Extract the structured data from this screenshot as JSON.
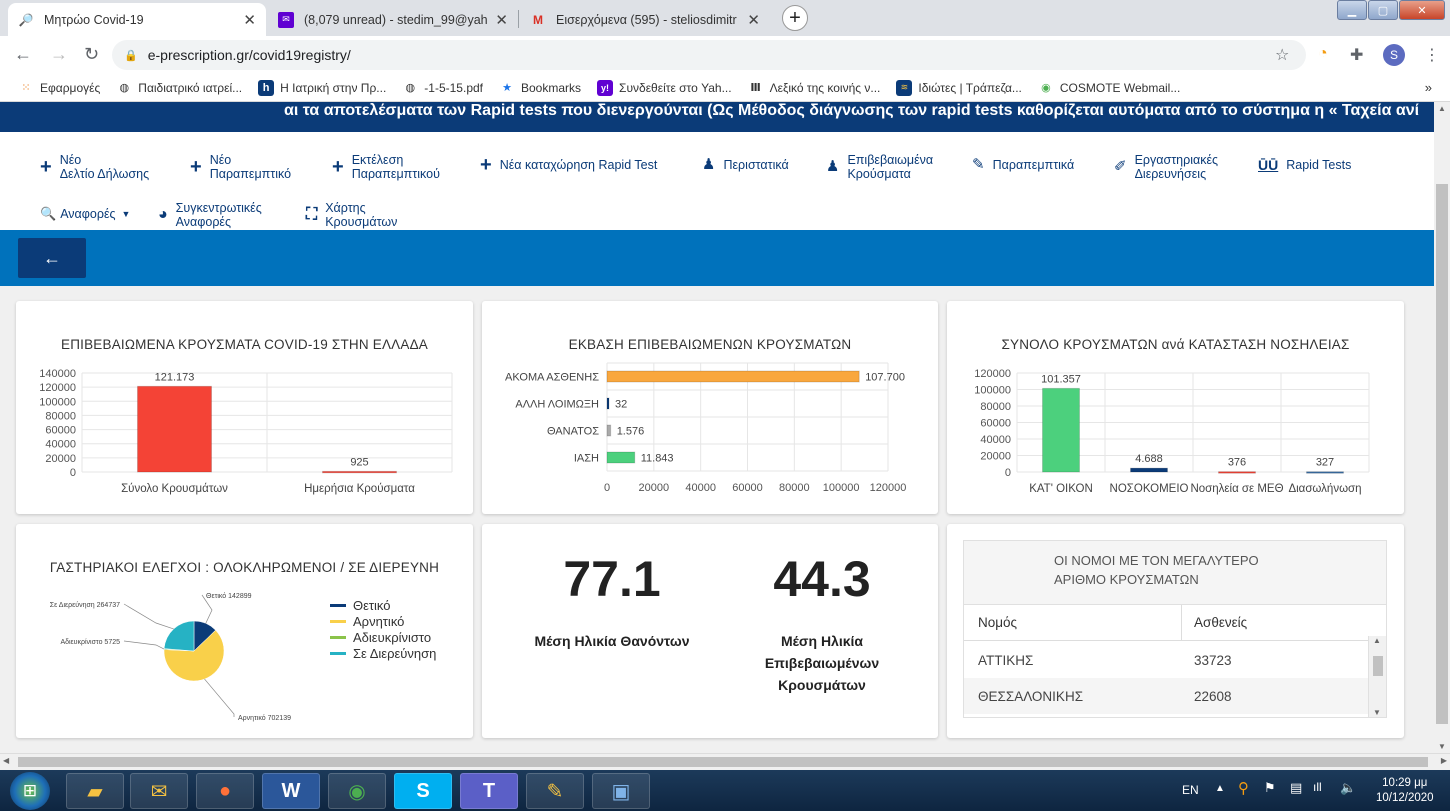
{
  "browser": {
    "tabs": [
      {
        "title": "Μητρώο Covid-19",
        "icon": "covid-registry-favicon",
        "active": true
      },
      {
        "title": "(8,079 unread) - stedim_99@yah",
        "icon": "yahoo-mail-favicon",
        "active": false
      },
      {
        "title": "Εισερχόμενα (595) - steliosdimitr",
        "icon": "gmail-favicon",
        "active": false
      }
    ],
    "url": "e-prescription.gr/covid19registry/",
    "profile_initial": "S",
    "bookmarks": [
      {
        "label": "Εφαρμογές",
        "icon": "apps-grid-icon"
      },
      {
        "label": "Παιδιατρικό ιατρεί...",
        "icon": "globe-icon"
      },
      {
        "label": "Η Ιατρική στην Πρ...",
        "icon": "h-site-icon"
      },
      {
        "label": "-1-5-15.pdf",
        "icon": "globe-icon"
      },
      {
        "label": "Bookmarks",
        "icon": "star-icon"
      },
      {
        "label": "Συνδεθείτε στο Yah...",
        "icon": "yahoo-icon"
      },
      {
        "label": "Λεξικό της κοινής ν...",
        "icon": "dictionary-icon"
      },
      {
        "label": "Ιδιώτες | Τράπεζα...",
        "icon": "bank-icon"
      },
      {
        "label": "COSMOTE Webmail...",
        "icon": "cosmote-icon"
      }
    ],
    "bookmarks_more": "»"
  },
  "page": {
    "marquee": "αι τα αποτελέσματα των Rapid tests που διενεργούνται (Ως Μέθοδος διάγνωσης των rapid tests καθορίζεται αυτόματα από το σύστημα η « Ταχεία ανί",
    "menu": [
      {
        "line1": "Νέο",
        "line2": "Δελτίο Δήλωσης",
        "icon": "plus-icon"
      },
      {
        "line1": "Νέο",
        "line2": "Παραπεμπτικό",
        "icon": "plus-icon"
      },
      {
        "line1": "Εκτέλεση",
        "line2": "Παραπεμπτικού",
        "icon": "plus-icon"
      },
      {
        "line1": "Νέα καταχώρηση Rapid Test",
        "line2": "",
        "icon": "plus-icon"
      },
      {
        "line1": "Περιστατικά",
        "line2": "",
        "icon": "user-doctor-icon"
      },
      {
        "line1": "Επιβεβαιωμένα",
        "line2": "Κρούσματα",
        "icon": "user-doctor-icon"
      },
      {
        "line1": "Παραπεμπτικά",
        "line2": "",
        "icon": "edit-document-icon"
      },
      {
        "line1": "Εργαστηριακές",
        "line2": "Διερευνήσεις",
        "icon": "syringe-icon"
      },
      {
        "line1": "Rapid Tests",
        "line2": "",
        "icon": "test-tubes-icon"
      },
      {
        "line1": "Αναφορές",
        "line2": "",
        "icon": "search-icon"
      },
      {
        "line1": "Συγκεντρωτικές",
        "line2": "Αναφορές",
        "icon": "pie-chart-icon"
      },
      {
        "line1": "Χάρτης",
        "line2": "Κρουσμάτων",
        "icon": "map-icon"
      }
    ],
    "back_label": "←",
    "kpi": {
      "age_deaths": "77.1",
      "age_deaths_label": [
        "Μέση Ηλικία Θανόντων"
      ],
      "age_cases": "44.3",
      "age_cases_label": [
        "Μέση Ηλικία",
        "Επιβεβαιωμένων",
        "Κρουσμάτων"
      ]
    },
    "top_nomoi": {
      "title": "ΟΙ ΝΟΜΟΙ ΜΕ ΤΟΝ ΜΕΓΑΛΥΤΕΡΟ ΑΡΙΘΜΟ ΚΡΟΥΣΜΑΤΩΝ",
      "headers": [
        "Νομός",
        "Ασθενείς"
      ],
      "rows": [
        [
          "ΑΤΤΙΚΗΣ",
          "33723"
        ],
        [
          "ΘΕΣΣΑΛΟΝΙΚΗΣ",
          "22608"
        ]
      ]
    }
  },
  "taskbar": {
    "lang": "EN",
    "time": "10:29 μμ",
    "date": "10/12/2020",
    "apps": [
      "explorer-icon",
      "outlook-icon",
      "firefox-icon",
      "word-icon",
      "chrome-icon",
      "skype-icon",
      "teams-icon",
      "paint-icon",
      "photos-icon"
    ]
  },
  "chart_data": [
    {
      "type": "bar",
      "title": "ΕΠΙΒΕΒΑΙΩΜΕΝΑ ΚΡΟΥΣΜΑΤΑ COVID-19 ΣΤΗΝ ΕΛΛΑΔΑ",
      "categories": [
        "Σύνολο Κρουσμάτων",
        "Ημερήσια Κρούσματα"
      ],
      "values": [
        121173,
        925
      ],
      "data_labels": [
        "121.173",
        "925"
      ],
      "colors": [
        "#f44336",
        "#f44336"
      ],
      "ylim": [
        0,
        140000
      ],
      "yticks": [
        0,
        20000,
        40000,
        60000,
        80000,
        100000,
        120000,
        140000
      ],
      "grid": true
    },
    {
      "type": "bar",
      "orientation": "horizontal",
      "title": "ΕΚΒΑΣΗ ΕΠΙΒΕΒΑΙΩΜΕΝΩΝ ΚΡΟΥΣΜΑΤΩΝ",
      "categories": [
        "ΑΚΟΜΑ ΑΣΘΕΝΗΣ",
        "ΑΛΛΗ ΛΟΙΜΩΞΗ",
        "ΘΑΝΑΤΟΣ",
        "ΙΑΣΗ"
      ],
      "values": [
        107700,
        32,
        1576,
        11843
      ],
      "data_labels": [
        "107.700",
        "32",
        "1.576",
        "11.843"
      ],
      "colors": [
        "#f9a73e",
        "#0b3b78",
        "#aaaaaa",
        "#4cd07d"
      ],
      "xlim": [
        0,
        120000
      ],
      "xticks": [
        0,
        20000,
        40000,
        60000,
        80000,
        100000,
        120000
      ],
      "grid": true
    },
    {
      "type": "bar",
      "title": "ΣΥΝΟΛΟ ΚΡΟΥΣΜΑΤΩΝ ανά ΚΑΤΑΣΤΑΣΗ ΝΟΣΗΛΕΙΑΣ",
      "categories": [
        "ΚΑΤ' ΟΙΚΟΝ",
        "ΝΟΣΟΚΟΜΕΙΟ",
        "Νοσηλεία σε ΜΕΘ",
        "Διασωλήνωση"
      ],
      "values": [
        101357,
        4688,
        376,
        327
      ],
      "data_labels": [
        "101.357",
        "4.688",
        "376",
        "327"
      ],
      "colors": [
        "#4cd07d",
        "#0b3b78",
        "#f44336",
        "#3a6ea5"
      ],
      "ylim": [
        0,
        120000
      ],
      "yticks": [
        0,
        20000,
        40000,
        60000,
        80000,
        100000,
        120000
      ],
      "grid": true
    },
    {
      "type": "pie",
      "title": "ΓΑΣΤΗΡΙΑΚΟΙ ΕΛΕΓΧΟΙ : ΟΛΟΚΛΗΡΩΜΕΝΟΙ / ΣΕ ΔΙΕΡΕΥΝΗ",
      "labels": [
        "Θετικό",
        "Αρνητικό",
        "Αδιευκρίνιστο",
        "Σε Διερεύνηση"
      ],
      "values": [
        142899,
        702139,
        5725,
        264737
      ],
      "slice_labels": [
        "Θετικό 142899",
        "Αρνητικό 702139",
        "Αδιευκρίνιστο 5725",
        "Σε Διερεύνηση 264737"
      ],
      "colors": [
        "#0b3b78",
        "#f9d04a",
        "#8bc34a",
        "#26b2c4"
      ],
      "legend": "right"
    }
  ]
}
